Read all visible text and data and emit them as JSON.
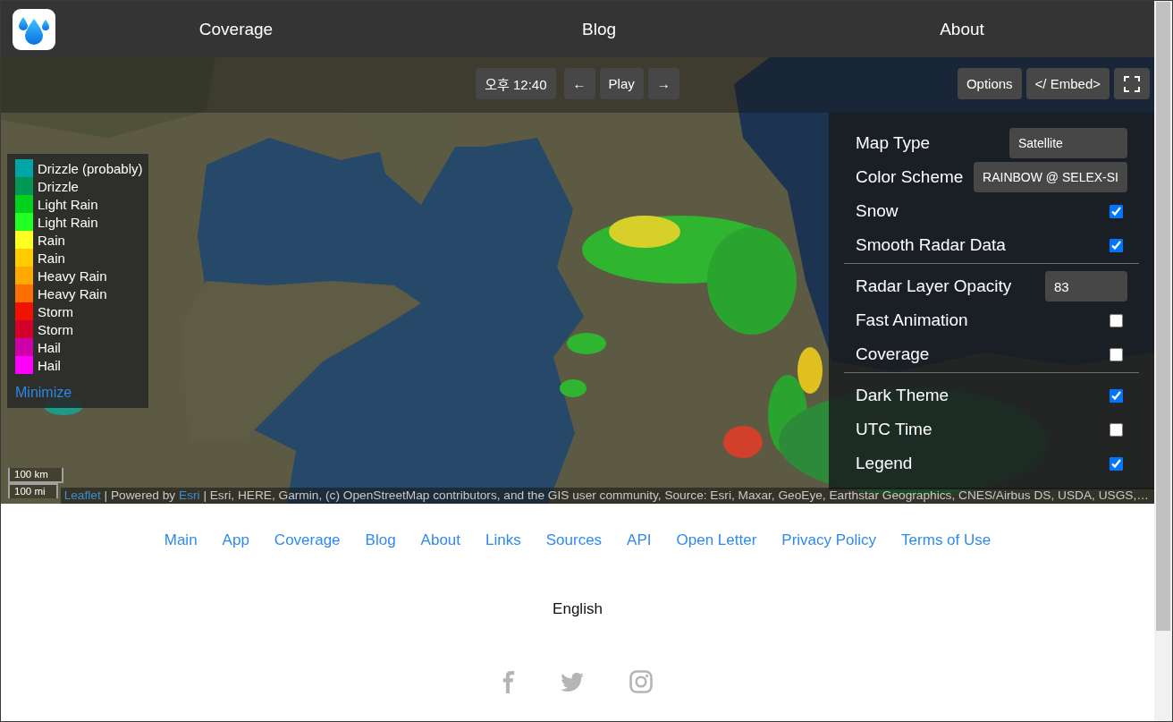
{
  "header": {
    "nav": [
      {
        "label": "Coverage"
      },
      {
        "label": "Blog"
      },
      {
        "label": "About"
      }
    ]
  },
  "map": {
    "toolbar": {
      "time": "오후 12:40",
      "previous": "←",
      "play": "Play",
      "next": "→",
      "options": "Options",
      "embed": "</ Embed>"
    },
    "legend": {
      "items": [
        {
          "label": "Drizzle (probably)",
          "color": "#00a5a5"
        },
        {
          "label": "Drizzle",
          "color": "#009656"
        },
        {
          "label": "Light Rain",
          "color": "#00d21e"
        },
        {
          "label": "Light Rain",
          "color": "#22ff22"
        },
        {
          "label": "Rain",
          "color": "#ffff22"
        },
        {
          "label": "Rain",
          "color": "#ffcc00"
        },
        {
          "label": "Heavy Rain",
          "color": "#ffa800"
        },
        {
          "label": "Heavy Rain",
          "color": "#ff6e00"
        },
        {
          "label": "Storm",
          "color": "#f01400"
        },
        {
          "label": "Storm",
          "color": "#d2002a"
        },
        {
          "label": "Hail",
          "color": "#d000a8"
        },
        {
          "label": "Hail",
          "color": "#ff00ff"
        }
      ],
      "minimize": "Minimize"
    },
    "options_panel": {
      "sections": [
        {
          "rows": [
            {
              "kind": "select",
              "label": "Map Type",
              "value": "Satellite"
            },
            {
              "kind": "select",
              "label": "Color Scheme",
              "value": "RAINBOW @ SELEX-SI"
            },
            {
              "kind": "checkbox",
              "label": "Snow",
              "checked": true
            },
            {
              "kind": "checkbox",
              "label": "Smooth Radar Data",
              "checked": true
            }
          ]
        },
        {
          "rows": [
            {
              "kind": "number",
              "label": "Radar Layer Opacity",
              "value": "83"
            },
            {
              "kind": "checkbox",
              "label": "Fast Animation",
              "checked": false
            },
            {
              "kind": "checkbox",
              "label": "Coverage",
              "checked": false
            }
          ]
        },
        {
          "rows": [
            {
              "kind": "checkbox",
              "label": "Dark Theme",
              "checked": true
            },
            {
              "kind": "checkbox",
              "label": "UTC Time",
              "checked": false
            },
            {
              "kind": "checkbox",
              "label": "Legend",
              "checked": true
            }
          ]
        }
      ]
    },
    "scale": [
      {
        "label": "100 km"
      },
      {
        "label": "100 mi"
      }
    ],
    "attribution": [
      {
        "kind": "link",
        "text": "Leaflet"
      },
      {
        "kind": "text",
        "text": " | Powered by "
      },
      {
        "kind": "link",
        "text": "Esri"
      },
      {
        "kind": "text",
        "text": " | Esri, HERE, Garmin, (c) OpenStreetMap contributors, and the GIS user community, Source: Esri, Maxar, GeoEye, Earthstar Geographics, CNES/Airbus DS, USDA, USGS,…"
      }
    ]
  },
  "footer": {
    "links": [
      {
        "label": "Main"
      },
      {
        "label": "App"
      },
      {
        "label": "Coverage"
      },
      {
        "label": "Blog"
      },
      {
        "label": "About"
      },
      {
        "label": "Links"
      },
      {
        "label": "Sources"
      },
      {
        "label": "API"
      },
      {
        "label": "Open Letter"
      },
      {
        "label": "Privacy Policy"
      },
      {
        "label": "Terms of Use"
      }
    ],
    "language": "English"
  }
}
